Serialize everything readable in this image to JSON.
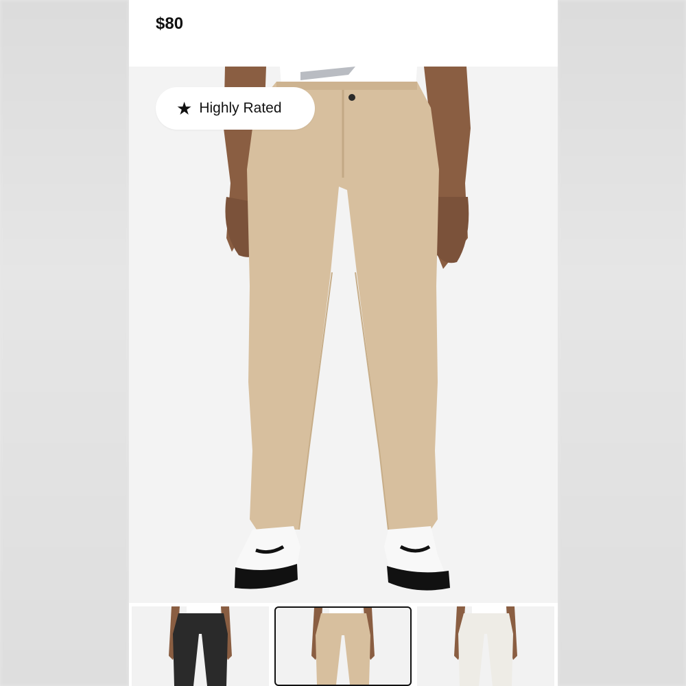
{
  "product": {
    "price": "$80"
  },
  "badge": {
    "icon": "star-icon",
    "label": "Highly Rated"
  },
  "colors": {
    "khaki": "#d7bf9e",
    "black": "#2a2a2a",
    "white": "#eeece6",
    "background": "#f3f3f3"
  },
  "thumbnails": [
    {
      "variant": "black",
      "selected": false
    },
    {
      "variant": "khaki",
      "selected": true
    },
    {
      "variant": "white",
      "selected": false
    }
  ]
}
